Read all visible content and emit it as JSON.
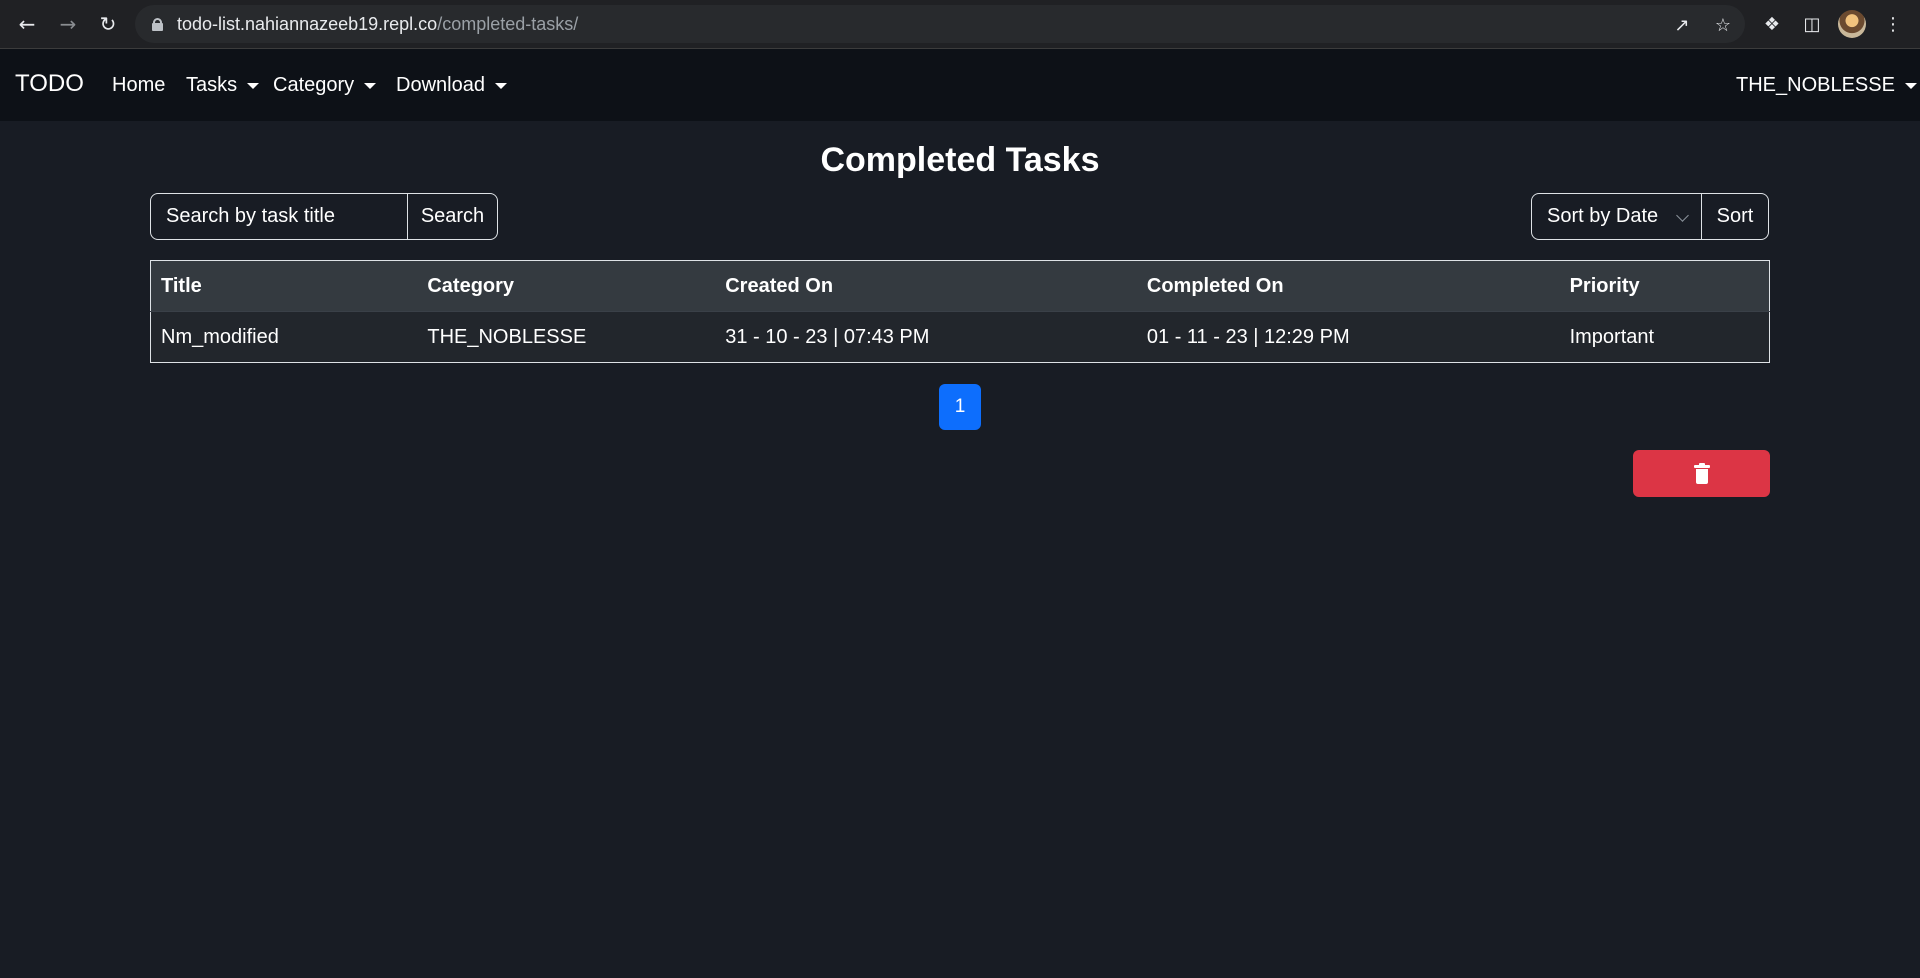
{
  "browser": {
    "url_host": "todo-list.nahiannazeeb19.repl.co",
    "url_path": "/completed-tasks/"
  },
  "navbar": {
    "brand": "TODO",
    "items": [
      {
        "label": "Home",
        "dropdown": false
      },
      {
        "label": "Tasks",
        "dropdown": true
      },
      {
        "label": "Category",
        "dropdown": true
      },
      {
        "label": "Download",
        "dropdown": true
      }
    ],
    "user": "THE_NOBLESSE"
  },
  "main": {
    "title": "Completed Tasks",
    "search": {
      "placeholder": "Search by task title",
      "button": "Search"
    },
    "sort": {
      "selected": "Sort by Date",
      "button": "Sort"
    },
    "table": {
      "headers": [
        "Title",
        "Category",
        "Created On",
        "Completed On",
        "Priority"
      ],
      "rows": [
        [
          "Nm_modified",
          "THE_NOBLESSE",
          "31 - 10 - 23 | 07:43 PM",
          "01 - 11 - 23 | 12:29 PM",
          "Important"
        ]
      ]
    },
    "pagination": {
      "current": "1"
    },
    "delete_button": {
      "icon": "trash-icon",
      "color": "#dc3545"
    }
  },
  "colors": {
    "background": "#181c24",
    "navbar": "#0d1117",
    "table_header": "#343a40",
    "accent": "#0d6efd",
    "danger": "#dc3545"
  }
}
